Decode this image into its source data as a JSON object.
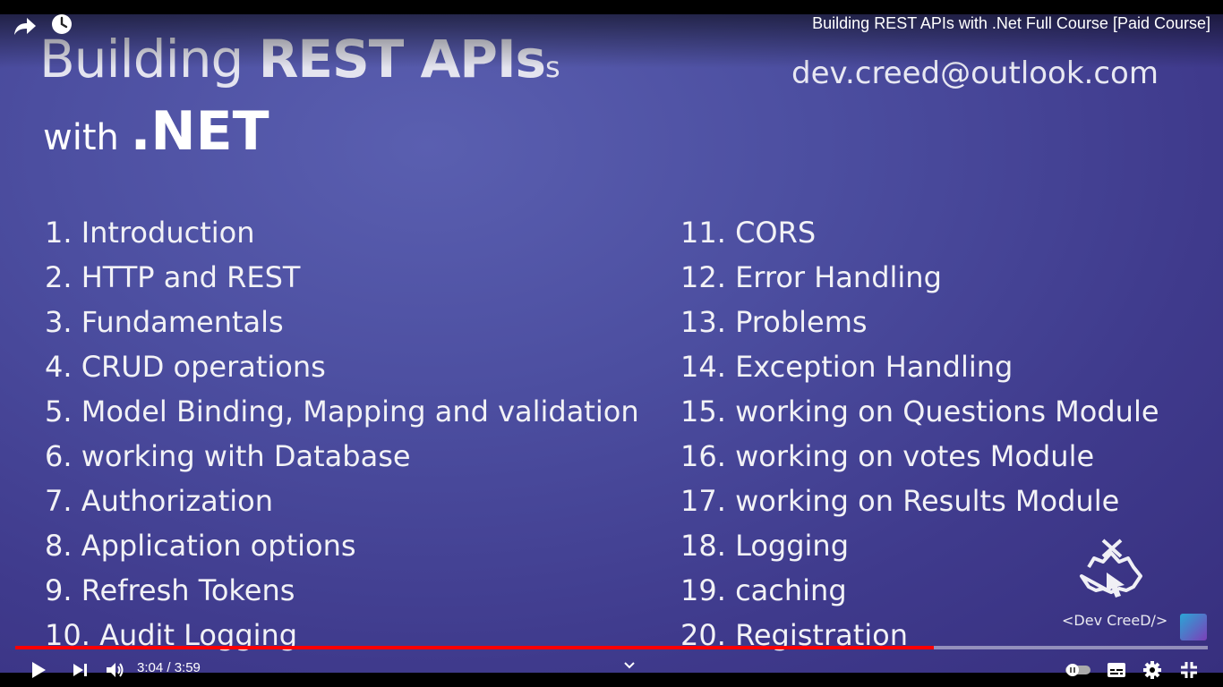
{
  "player": {
    "video_title": "Building REST APIs with .Net Full Course [Paid Course]",
    "time_display": "3:04 / 3:59",
    "progress": 0.77,
    "accent_color": "#ff0000"
  },
  "slide": {
    "title_part1": "Building ",
    "title_part2": "REST APIs",
    "title_suffix": "s",
    "title_with": "with ",
    "title_net": ".NET",
    "email": "dev.creed@outlook.com",
    "left_items": [
      "1. Introduction",
      "2. HTTP and REST",
      "3. Fundamentals",
      "4. CRUD operations",
      "5. Model Binding, Mapping and validation",
      "6. working with Database",
      "7. Authorization",
      "8. Application options",
      "9. Refresh Tokens",
      "10. Audit Logging"
    ],
    "right_items": [
      "11. CORS",
      "12. Error Handling",
      "13. Problems",
      "14. Exception Handling",
      "15. working on Questions Module",
      "16. working on votes Module",
      "17. working on Results Module",
      "18. Logging",
      "19. caching",
      "20. Registration"
    ],
    "logo_text": "<Dev CreeD/>"
  },
  "icons": {
    "share": "share-icon",
    "watch_later": "clock-icon",
    "play": "play-icon",
    "next": "next-icon",
    "volume": "volume-icon",
    "chevron": "chevron-down-icon",
    "autoplay": "autoplay-toggle-icon",
    "subtitles": "subtitles-icon",
    "settings": "gear-icon",
    "exit_fullscreen": "exit-fullscreen-icon"
  }
}
